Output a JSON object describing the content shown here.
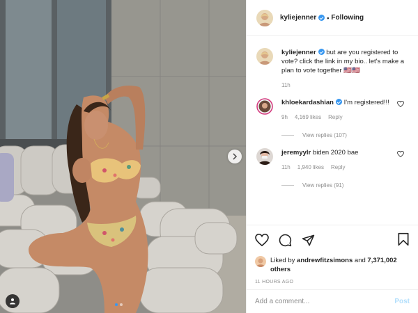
{
  "post_author": {
    "username": "kyliejenner",
    "verified": true,
    "follow_status": "Following",
    "separator": "•"
  },
  "caption": {
    "username": "kyliejenner",
    "text": "but are you registered to vote? click the link in my bio.. let's make a plan to vote together 🇺🇸🇺🇸",
    "time": "11h"
  },
  "comments": [
    {
      "username": "khloekardashian",
      "verified": true,
      "text": "I'm registered!!!",
      "time": "9h",
      "likes": "4,169 likes",
      "reply_label": "Reply",
      "view_replies": "View replies (107)"
    },
    {
      "username": "jeremyylr",
      "verified": false,
      "text": "biden 2020 bae",
      "time": "11h",
      "likes": "1,940 likes",
      "reply_label": "Reply",
      "view_replies": "View replies (91)"
    }
  ],
  "likes": {
    "prefix": "Liked by",
    "first_liker": "andrewfitzsimons",
    "middle": "and",
    "others": "7,371,002 others"
  },
  "timestamp": "11 HOURS AGO",
  "add_comment": {
    "placeholder": "Add a comment...",
    "post_label": "Post"
  },
  "carousel": {
    "total_slides": 2,
    "active_index": 0
  },
  "colors": {
    "accent": "#3897f0",
    "post_disabled": "#b2dffc",
    "meta_gray": "#8e8e8e"
  },
  "icons": [
    "heart-icon",
    "comment-icon",
    "share-icon",
    "save-icon",
    "chevron-right-icon",
    "user-tag-icon",
    "verified-icon"
  ]
}
